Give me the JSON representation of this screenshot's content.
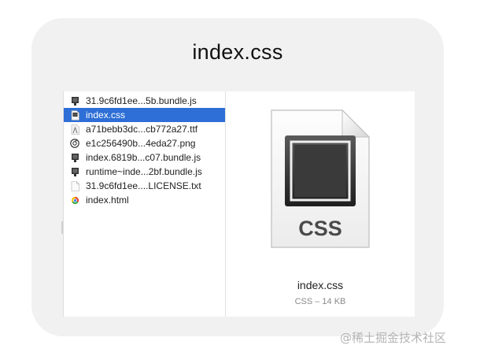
{
  "window": {
    "title": "index.css"
  },
  "files": [
    {
      "name": "31.9c6fd1ee...5b.bundle.js",
      "icon": "js-file-icon",
      "selected": false
    },
    {
      "name": "index.css",
      "icon": "css-file-icon",
      "selected": true
    },
    {
      "name": "a71bebb3dc...cb772a27.ttf",
      "icon": "font-file-icon",
      "selected": false
    },
    {
      "name": "e1c256490b...4eda27.png",
      "icon": "png-file-icon",
      "selected": false
    },
    {
      "name": "index.6819b...c07.bundle.js",
      "icon": "js-file-icon",
      "selected": false
    },
    {
      "name": "runtime~inde...2bf.bundle.js",
      "icon": "js-file-icon",
      "selected": false
    },
    {
      "name": "31.9c6fd1ee....LICENSE.txt",
      "icon": "text-file-icon",
      "selected": false
    },
    {
      "name": "index.html",
      "icon": "html-file-icon",
      "selected": false
    }
  ],
  "preview": {
    "icon_label": "CSS",
    "file_name": "index.css",
    "meta": "CSS – 14 KB"
  },
  "watermark": "@稀土掘金技术社区",
  "colors": {
    "selection": "#2d6fd6",
    "card_background": "#f1f1f1"
  }
}
